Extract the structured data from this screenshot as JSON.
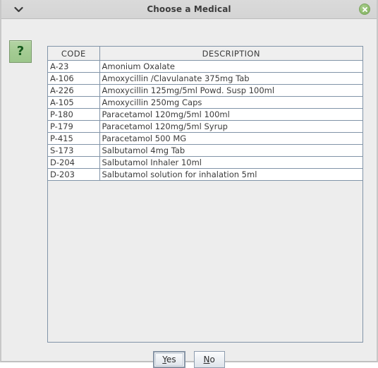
{
  "window": {
    "title": "Choose a Medical",
    "menu_icon": "chevron-down-icon",
    "close_icon": "close-icon"
  },
  "help_button": {
    "label": "?",
    "icon": "question-mark-icon"
  },
  "table": {
    "columns": [
      "CODE",
      "DESCRIPTION"
    ],
    "rows": [
      {
        "code": "A-23",
        "description": "Amonium Oxalate"
      },
      {
        "code": "A-106",
        "description": "Amoxycillin /Clavulanate 375mg Tab"
      },
      {
        "code": "A-226",
        "description": "Amoxycillin 125mg/5ml Powd. Susp 100ml"
      },
      {
        "code": "A-105",
        "description": "Amoxycillin 250mg Caps"
      },
      {
        "code": "P-180",
        "description": "Paracetamol 120mg/5ml 100ml"
      },
      {
        "code": "P-179",
        "description": "Paracetamol 120mg/5ml Syrup"
      },
      {
        "code": "P-415",
        "description": "Paracetamol 500 MG"
      },
      {
        "code": "S-173",
        "description": "Salbutamol 4mg Tab"
      },
      {
        "code": "D-204",
        "description": "Salbutamol Inhaler 10ml"
      },
      {
        "code": "D-203",
        "description": "Salbutamol solution for inhalation 5ml"
      }
    ]
  },
  "footer": {
    "yes_mnemonic": "Y",
    "yes_rest": "es",
    "no_mnemonic": "N",
    "no_rest": "o"
  },
  "colors": {
    "accent_green": "#8fbc6e",
    "help_green": "#a4cb93",
    "border_blue": "#8194a8",
    "titlebar": "#d6d6d6",
    "dialog_bg": "#ededed"
  }
}
